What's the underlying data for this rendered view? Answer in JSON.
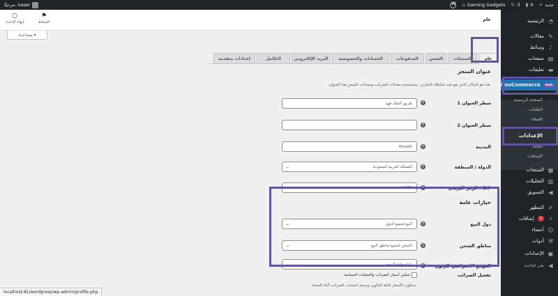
{
  "admin_bar": {
    "site_name": "Gaming Gadgets",
    "updates_count": "3",
    "comments_count": "0",
    "new_label": "جديد",
    "greeting": "مرحبًا، naser"
  },
  "sidebar": {
    "items": [
      {
        "label": "الرئيسية",
        "icon": "dashboard-icon"
      },
      {
        "label": "مقالات",
        "icon": "pin-icon"
      },
      {
        "label": "وسائط",
        "icon": "media-icon"
      },
      {
        "label": "صفحات",
        "icon": "pages-icon"
      },
      {
        "label": "تعليقات",
        "icon": "comments-icon"
      },
      {
        "label": "WooCommerce",
        "icon": "woo-icon",
        "badge": "woo"
      },
      {
        "label": "المنتجات",
        "icon": "products-icon"
      },
      {
        "label": "التحليلات",
        "icon": "analytics-icon"
      },
      {
        "label": "التسويق",
        "icon": "megaphone-icon"
      },
      {
        "label": "المظهر",
        "icon": "brush-icon"
      },
      {
        "label": "إضافات",
        "icon": "plugin-icon",
        "count": "3"
      },
      {
        "label": "أعضاء",
        "icon": "users-icon"
      },
      {
        "label": "أدوات",
        "icon": "tools-icon"
      },
      {
        "label": "الإعدادات",
        "icon": "settings-icon"
      },
      {
        "label": "طي القائمة",
        "icon": "collapse-icon"
      }
    ],
    "wc_sub": [
      "الصفحة الرئيسية",
      "الطلبات",
      "العملاء",
      "الإعدادات",
      "الحالة",
      "الإضافات"
    ]
  },
  "header": {
    "page_title": "عام",
    "activity_label": "النشاط",
    "finish_setup_label": "إنهاء الإعداد",
    "help_label": "مساعدة ▾"
  },
  "tabs": [
    "عام",
    "المنتجات",
    "الشحن",
    "المدفوعات",
    "الحسابات والخصوصية",
    "البريد الإلكتروني",
    "التكامل",
    "إعدادات متقدمة"
  ],
  "store_address": {
    "title": "عنوان المتجر",
    "description": "هذا هو المكان الذي يقع فيه نشاطك التجاري. ستستخدم معدلات الضرائب ومعدلات الشحن هذا العنوان.",
    "fields": [
      {
        "label": "سطر العنوان 1",
        "value": "طريق الملك فهد"
      },
      {
        "label": "سطر العنوان 2",
        "value": ""
      },
      {
        "label": "المدينة",
        "value": "Riyadh"
      },
      {
        "label": "الدولة / المنطقة",
        "value": "المملكة العربية السعودية"
      },
      {
        "label": "الرمز البريدي / ZIP",
        "value": "1236"
      }
    ]
  },
  "general_options": {
    "title": "خيارات عامة",
    "fields": [
      {
        "label": "دول البيع",
        "value": "البيع لجميع الدول"
      },
      {
        "label": "مناطق الشحن",
        "value": "الشحن لجميع مناطق البيع"
      },
      {
        "label": "الموقع الافتراضي للزبون",
        "value": "بلد/منطقة المتجر"
      }
    ]
  },
  "taxes": {
    "label": "تفعيل الضرائب",
    "checkbox_label": "تمكين أسعار الضرائب والعمليات الحسابية",
    "description": "ستكون الأسعار قابلة للتكوين وسيتم احتساب الضرائب أثناء السداد."
  },
  "status_bar": "localhost:81/wordpress/wp-admin/profile.php"
}
